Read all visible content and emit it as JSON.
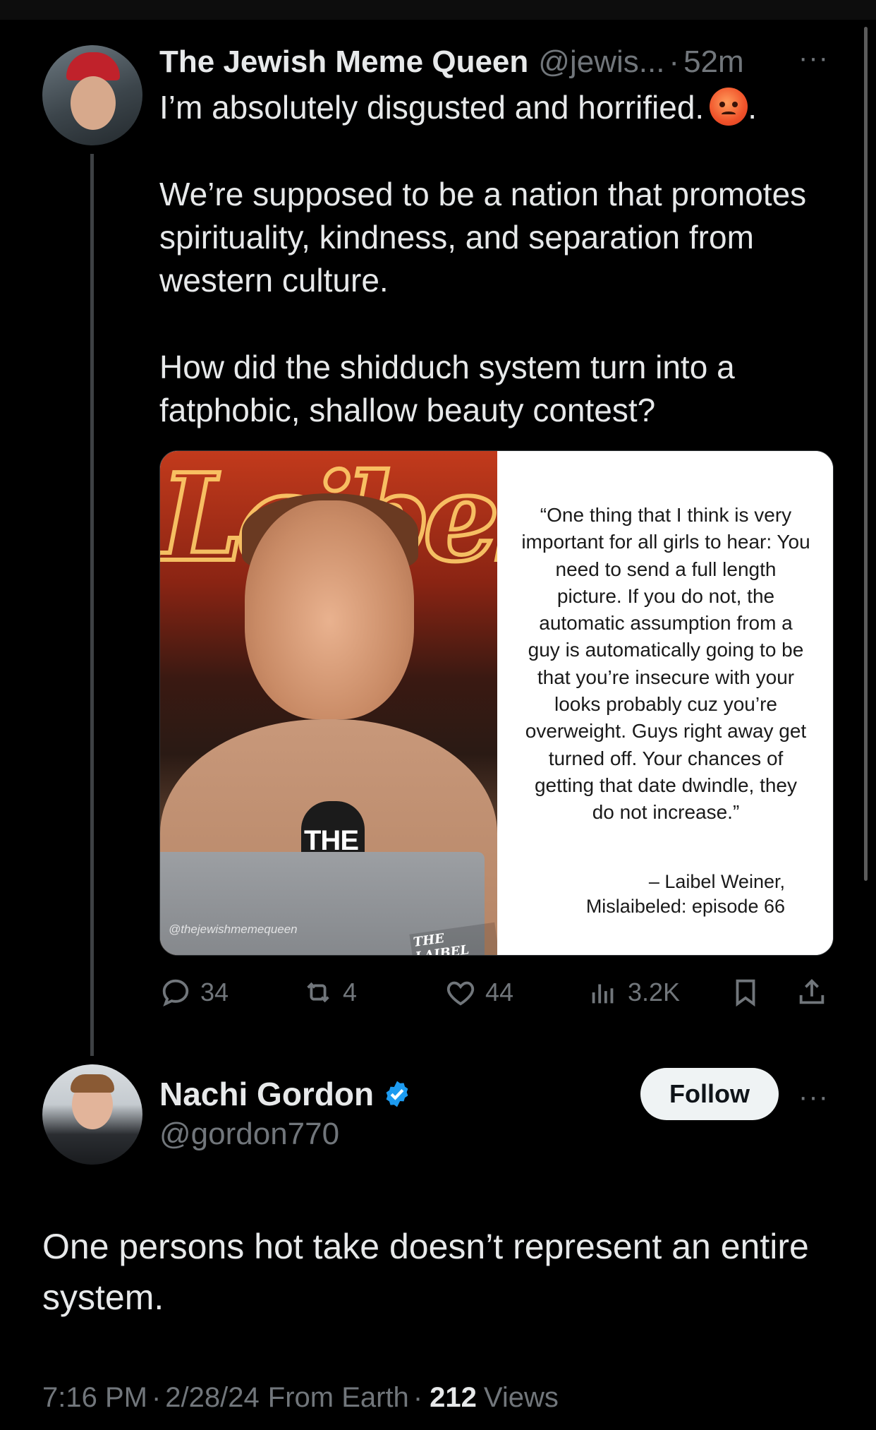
{
  "post": {
    "author_name": "The Jewish Meme Queen",
    "author_handle": "@jewis...",
    "time": "52m",
    "separator": "·",
    "more": "···",
    "line1": "I’m absolutely disgusted and horrified.",
    "line1_end": ".",
    "emoji": "angry-face",
    "paragraph2": "We’re supposed to be a nation that promotes spirituality, kindness, and separation from western culture.",
    "paragraph3": "How did the shidduch system turn into a fatphobic, shallow beauty contest?",
    "media": {
      "photo_mic_text": "THE",
      "photo_watermark": "@thejewishmemequeen",
      "photo_logo": "THE LAIBEL",
      "quote": "“One thing that I think is very important for all girls to hear: You need to send a full length picture. If you do not, the automatic assumption from a guy is automatically going to be that you’re insecure with your looks probably cuz you’re overweight. Guys right away get turned off. Your chances of getting that date dwindle, they do not increase.”",
      "attribution_line1": "– Laibel Weiner,",
      "attribution_line2": "Mislaibeled: episode 66"
    },
    "actions": {
      "replies": "34",
      "reposts": "4",
      "likes": "44",
      "views": "3.2K"
    }
  },
  "reply": {
    "author_name": "Nachi Gordon",
    "author_handle": "@gordon770",
    "verified": true,
    "follow_label": "Follow",
    "more": "···",
    "text": "One persons hot take doesn’t represent an entire system.",
    "time": "7:16 PM",
    "date": "2/28/24",
    "source": "From Earth",
    "views_count": "212",
    "views_label": "Views",
    "separator": "·"
  },
  "colors": {
    "background": "#000000",
    "text": "#e7e9ea",
    "secondary": "#71767b",
    "verified": "#1d9bf0",
    "follow_bg": "#eff3f4"
  }
}
